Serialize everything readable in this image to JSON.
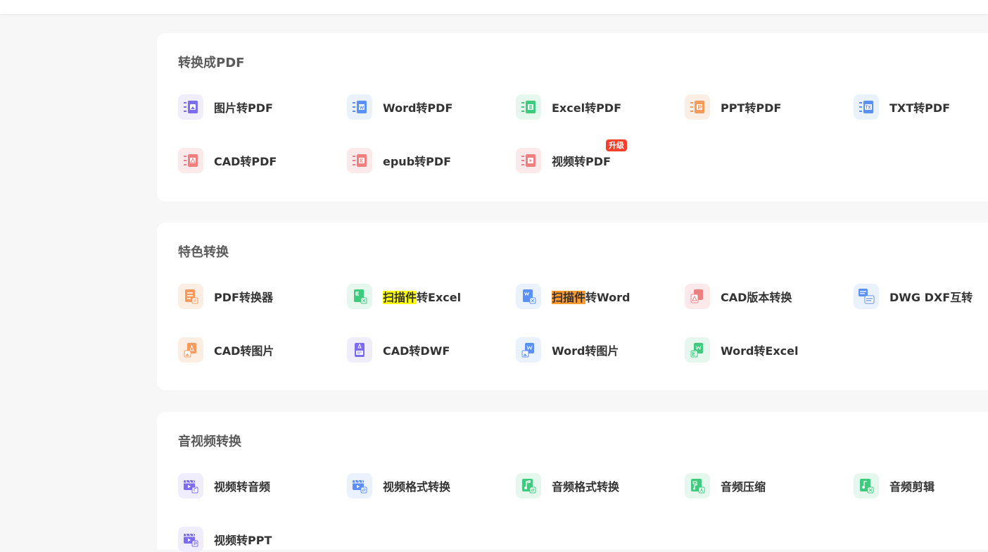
{
  "colors": {
    "purple": "#7b6cf0",
    "purple_bg": "#efedff",
    "blue": "#5b8ff9",
    "blue_bg": "#eaf1ff",
    "green": "#3ecb7e",
    "green_bg": "#e6f8ee",
    "orange": "#f79a5c",
    "orange_bg": "#fdeee3",
    "red": "#ef7f7f",
    "red_bg": "#fde9e9",
    "badge": "#f5402c"
  },
  "sections": [
    {
      "title": "转换成PDF",
      "items": [
        {
          "label": "图片转PDF",
          "icon": "image-to-pdf-icon",
          "color": "purple"
        },
        {
          "label": "Word转PDF",
          "icon": "word-to-pdf-icon",
          "color": "blue"
        },
        {
          "label": "Excel转PDF",
          "icon": "excel-to-pdf-icon",
          "color": "green"
        },
        {
          "label": "PPT转PDF",
          "icon": "ppt-to-pdf-icon",
          "color": "orange"
        },
        {
          "label": "TXT转PDF",
          "icon": "txt-to-pdf-icon",
          "color": "blue"
        },
        {
          "label": "CAD转PDF",
          "icon": "cad-to-pdf-icon",
          "color": "red"
        },
        {
          "label": "epub转PDF",
          "icon": "epub-to-pdf-icon",
          "color": "red"
        },
        {
          "label": "视频转PDF",
          "icon": "video-to-pdf-icon",
          "color": "red",
          "badge": "升级"
        }
      ]
    },
    {
      "title": "特色转换",
      "items": [
        {
          "label": "PDF转换器",
          "icon": "pdf-converter-icon",
          "color": "orange"
        },
        {
          "label_hl": "扫描件",
          "label_rest": "转Excel",
          "hl": "yellow",
          "icon": "scan-to-excel-icon",
          "color": "green"
        },
        {
          "label_hl": "扫描件",
          "label_rest": "转Word",
          "hl": "orange",
          "icon": "scan-to-word-icon",
          "color": "blue"
        },
        {
          "label": "CAD版本转换",
          "icon": "cad-version-convert-icon",
          "color": "red"
        },
        {
          "label": "DWG DXF互转",
          "icon": "dwg-dxf-convert-icon",
          "color": "blue"
        },
        {
          "label": "CAD转图片",
          "icon": "cad-to-image-icon",
          "color": "orange"
        },
        {
          "label": "CAD转DWF",
          "icon": "cad-to-dwf-icon",
          "color": "purple"
        },
        {
          "label": "Word转图片",
          "icon": "word-to-image-icon",
          "color": "blue"
        },
        {
          "label": "Word转Excel",
          "icon": "word-to-excel-icon",
          "color": "green"
        }
      ]
    },
    {
      "title": "音视频转换",
      "items": [
        {
          "label": "视频转音频",
          "icon": "video-to-audio-icon",
          "color": "purple"
        },
        {
          "label": "视频格式转换",
          "icon": "video-format-convert-icon",
          "color": "blue"
        },
        {
          "label": "音频格式转换",
          "icon": "audio-format-convert-icon",
          "color": "green"
        },
        {
          "label": "音频压缩",
          "icon": "audio-compress-icon",
          "color": "green"
        },
        {
          "label": "音频剪辑",
          "icon": "audio-edit-icon",
          "color": "green"
        },
        {
          "label": "视频转PPT",
          "icon": "video-to-ppt-icon",
          "color": "purple"
        }
      ]
    }
  ]
}
